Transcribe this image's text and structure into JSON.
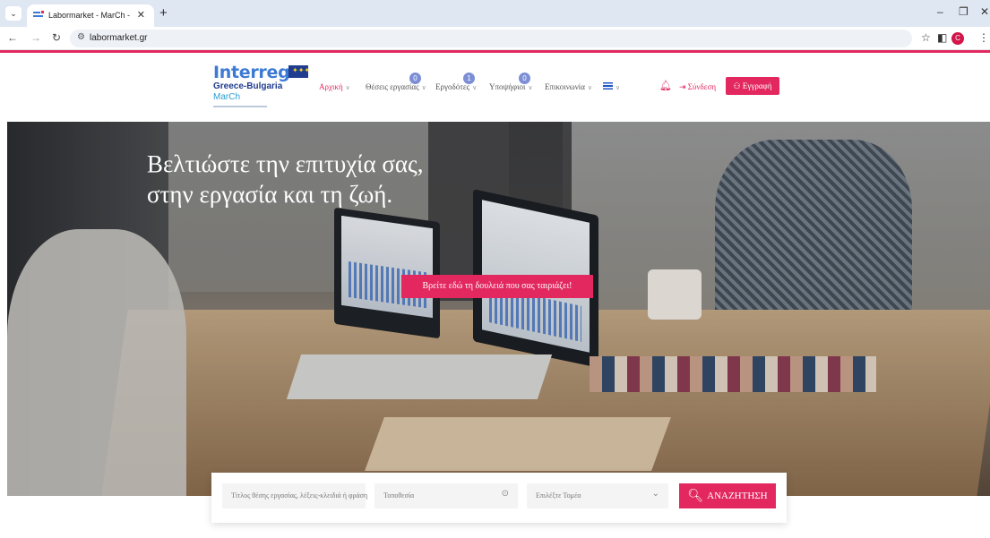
{
  "browser": {
    "tab_title": "Labormarket - MarCh - Market",
    "url": "labormarket.gr",
    "profile_initial": "C"
  },
  "logo": {
    "name": "Interreg",
    "line1": "Greece-Bulgaria",
    "line2": "MarCh"
  },
  "nav": {
    "items": [
      {
        "label": "Αρχική",
        "active": true
      },
      {
        "label": "Θέσεις εργασίας",
        "badge": "0"
      },
      {
        "label": "Εργοδότες",
        "badge": "1"
      },
      {
        "label": "Υποψήφιοι",
        "badge": "0"
      },
      {
        "label": "Επικοινωνία"
      }
    ],
    "login": "Σύνδεση",
    "register": "Εγγραφή"
  },
  "hero": {
    "headline_line1": "Βελτιώστε την επιτυχία σας,",
    "headline_line2": "στην εργασία και τη ζωή.",
    "cta": "Βρείτε εδώ τη δουλειά που σας ταιριάζει!"
  },
  "search": {
    "keyword_placeholder": "Τίτλος θέσης εργασίας, λέξεις-κλειδιά ή φράση",
    "location_placeholder": "Τοποθεσία",
    "sector_placeholder": "Επιλέξτε Τομέα",
    "button": "ΑΝΑΖΗΤΗΣΗ"
  },
  "colors": {
    "accent": "#e2285f",
    "badge": "#7c8fd6",
    "brand_blue": "#3d7ad4"
  }
}
